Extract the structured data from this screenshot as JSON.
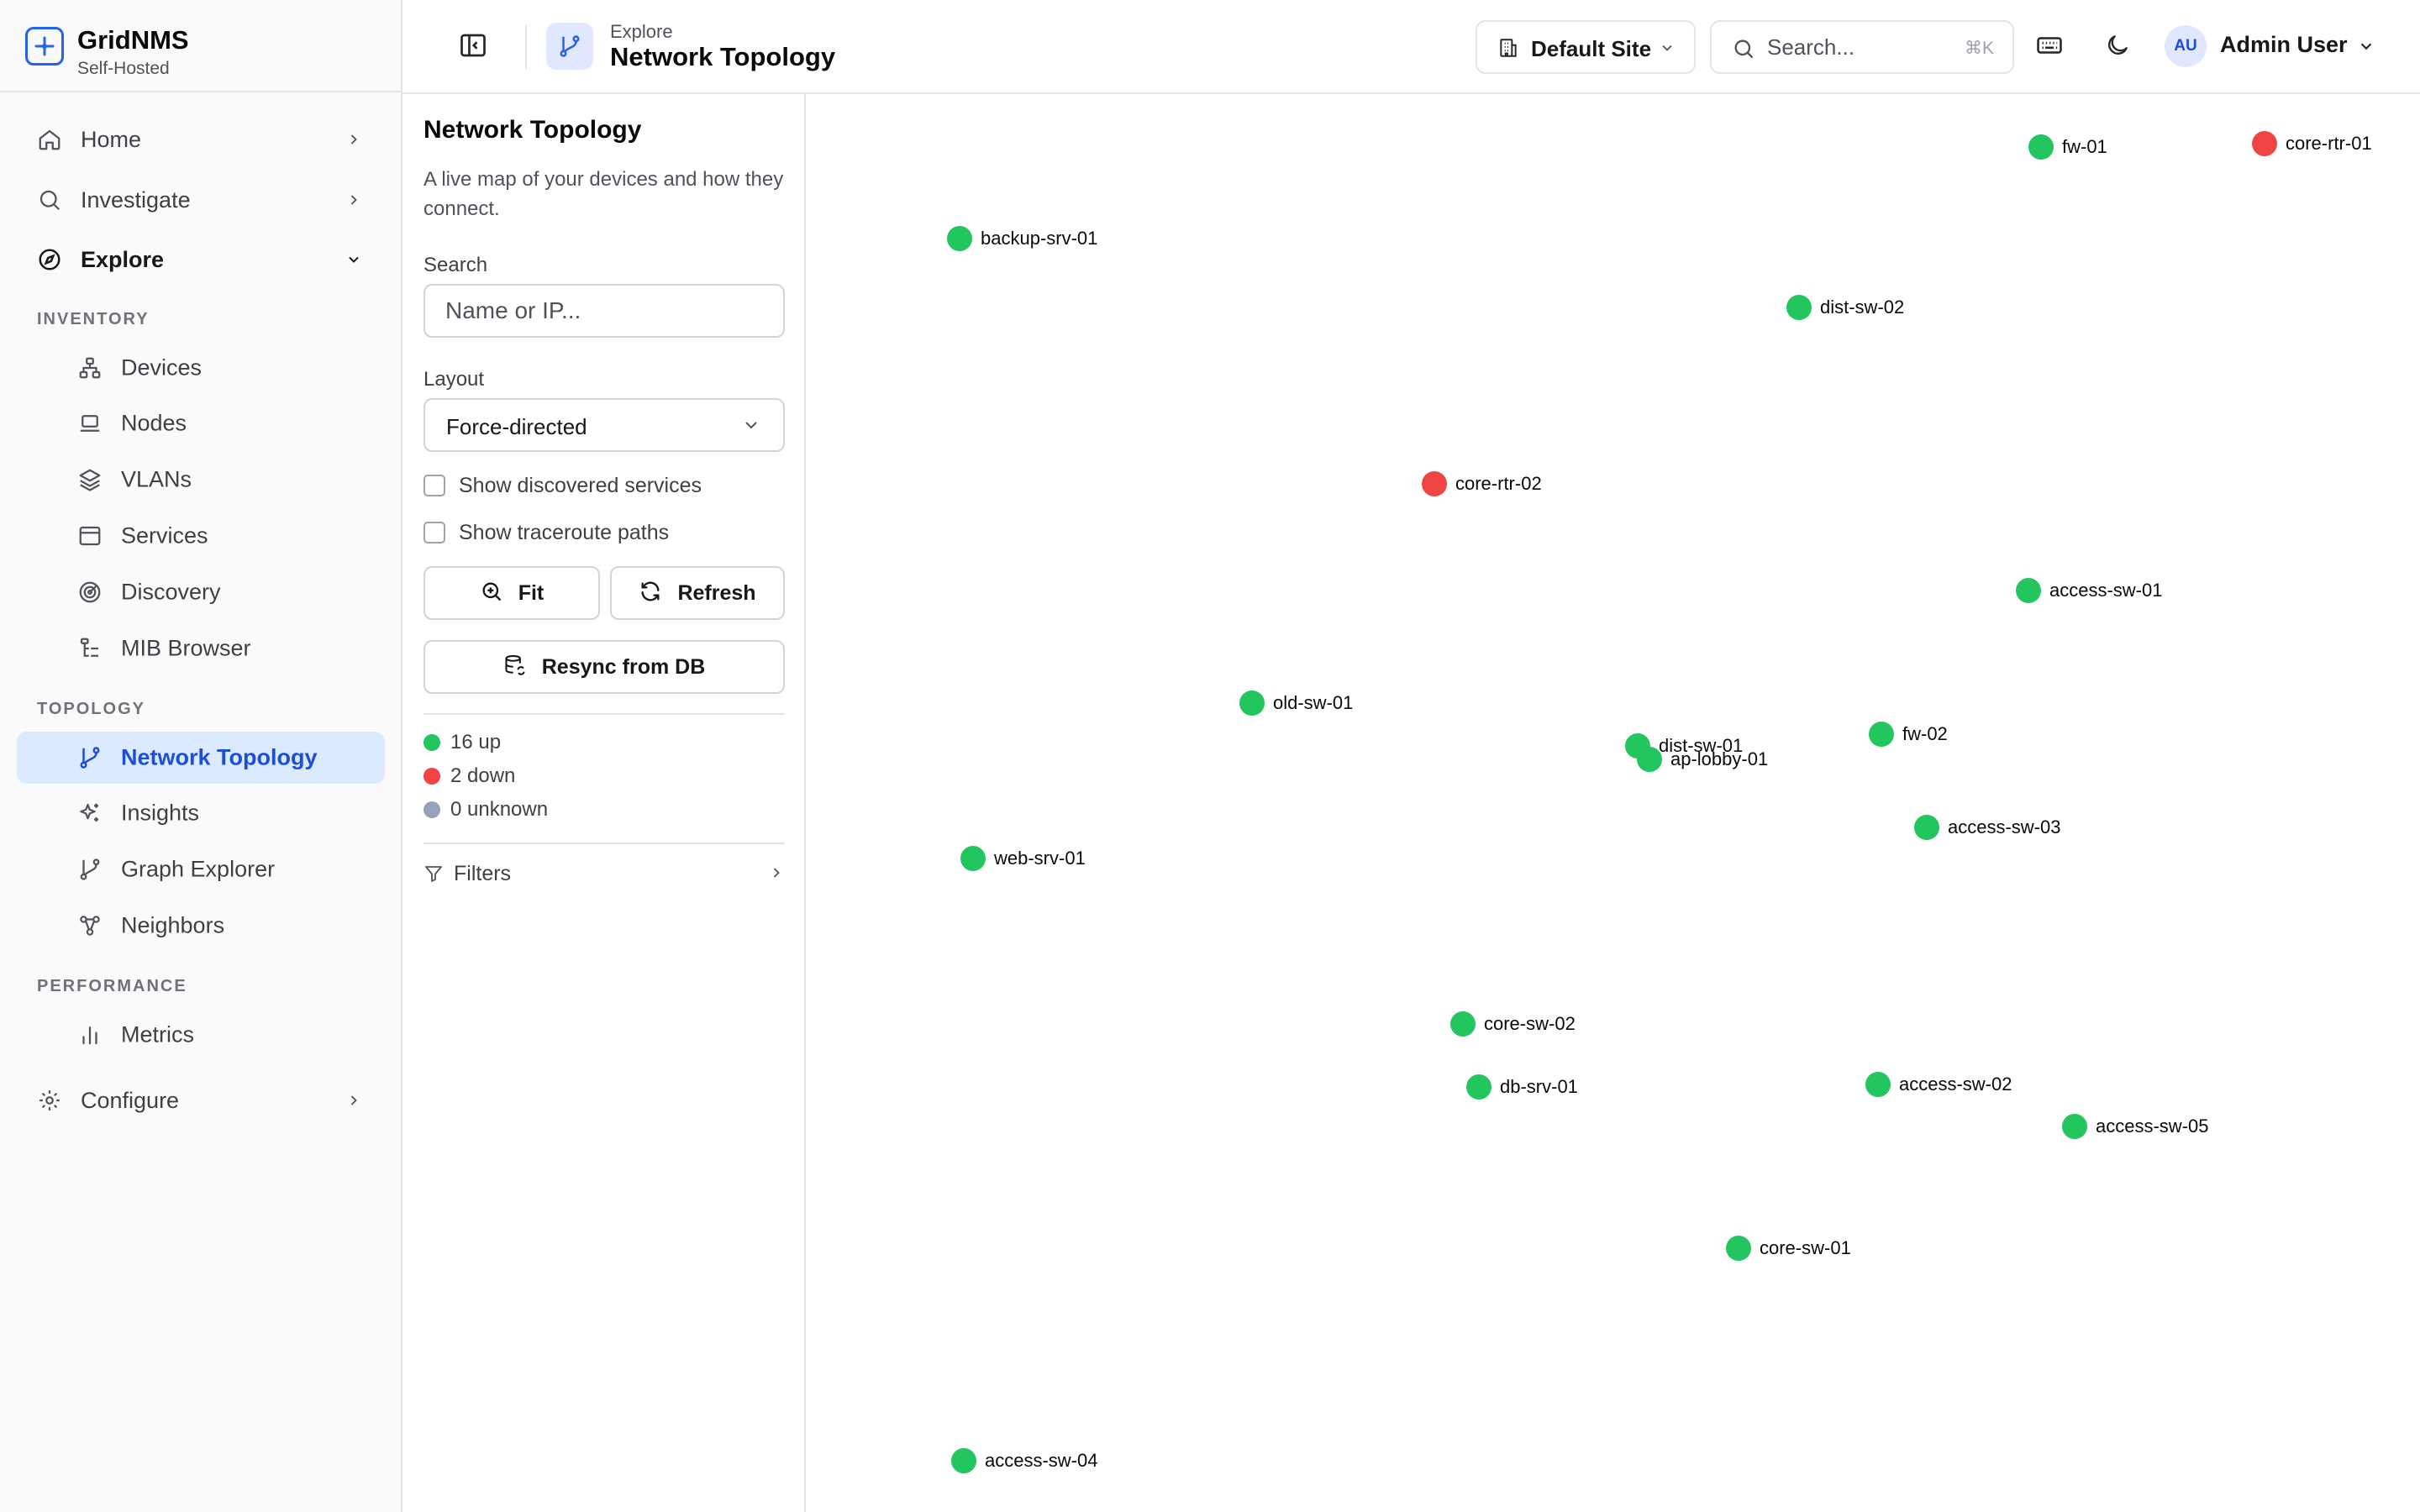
{
  "brand": {
    "name": "GridNMS",
    "subtitle": "Self-Hosted",
    "accent": "#2563eb"
  },
  "sidebar": {
    "home": "Home",
    "investigate": "Investigate",
    "explore": "Explore",
    "inventory_label": "INVENTORY",
    "inventory": [
      "Devices",
      "Nodes",
      "VLANs",
      "Services",
      "Discovery",
      "MIB Browser"
    ],
    "topology_label": "TOPOLOGY",
    "topology": [
      "Network Topology",
      "Insights",
      "Graph Explorer",
      "Neighbors"
    ],
    "performance_label": "PERFORMANCE",
    "performance": [
      "Metrics"
    ],
    "configure": "Configure"
  },
  "header": {
    "breadcrumb": "Explore",
    "title": "Network Topology",
    "site": "Default Site",
    "search_placeholder": "Search...",
    "search_shortcut": "⌘K",
    "user_initials": "AU",
    "user_name": "Admin User"
  },
  "panel": {
    "title": "Network Topology",
    "description": "A live map of your devices and how they connect.",
    "search_label": "Search",
    "search_placeholder": "Name or IP...",
    "layout_label": "Layout",
    "layout_value": "Force-directed",
    "show_services": "Show discovered services",
    "show_traceroute": "Show traceroute paths",
    "fit": "Fit",
    "refresh": "Refresh",
    "resync": "Resync from DB",
    "status": {
      "up": "16 up",
      "down": "2 down",
      "unknown": "0 unknown"
    },
    "filters": "Filters"
  },
  "colors": {
    "up": "#22c55e",
    "down": "#ef4444",
    "unknown": "#94a3b8"
  },
  "nodes": [
    {
      "name": "fw-01",
      "status": "up"
    },
    {
      "name": "core-rtr-01",
      "status": "down"
    },
    {
      "name": "backup-srv-01",
      "status": "up"
    },
    {
      "name": "dist-sw-02",
      "status": "up"
    },
    {
      "name": "core-rtr-02",
      "status": "down"
    },
    {
      "name": "access-sw-01",
      "status": "up"
    },
    {
      "name": "old-sw-01",
      "status": "up"
    },
    {
      "name": "dist-sw-01",
      "status": "up"
    },
    {
      "name": "ap-lobby-01",
      "status": "up"
    },
    {
      "name": "fw-02",
      "status": "up"
    },
    {
      "name": "access-sw-03",
      "status": "up"
    },
    {
      "name": "web-srv-01",
      "status": "up"
    },
    {
      "name": "core-sw-02",
      "status": "up"
    },
    {
      "name": "db-srv-01",
      "status": "up"
    },
    {
      "name": "access-sw-02",
      "status": "up"
    },
    {
      "name": "access-sw-05",
      "status": "up"
    },
    {
      "name": "core-sw-01",
      "status": "up"
    },
    {
      "name": "access-sw-04",
      "status": "up"
    }
  ]
}
